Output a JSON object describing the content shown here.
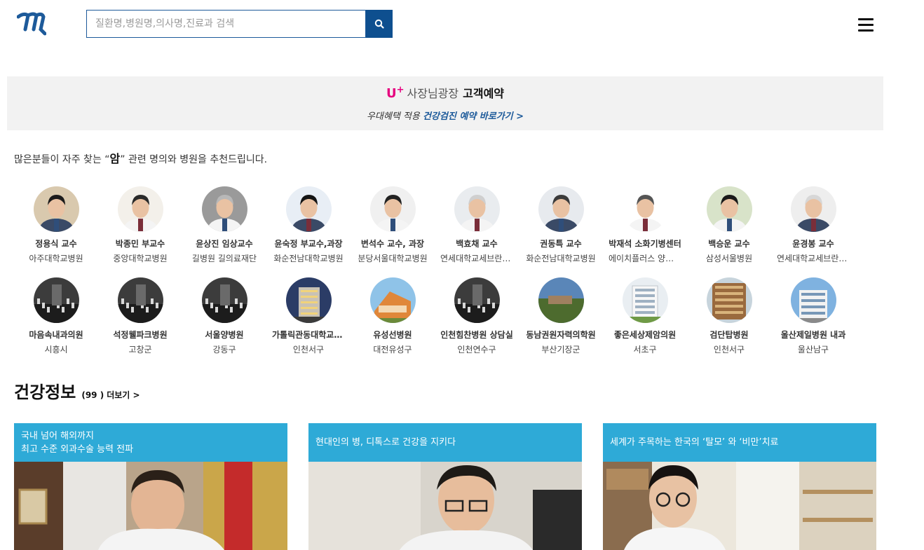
{
  "header": {
    "search_placeholder": "질환명,병원명,의사명,진료과 검색"
  },
  "banner": {
    "brand": "U",
    "brand_plus": "+",
    "brand_name": "사장님광장",
    "title_strong": "고객예약",
    "sub_prefix": "우대혜택 적용 ",
    "sub_link": "건강검진 예약 바로가기 >"
  },
  "recommend": {
    "prefix": "많은분들이 자주 찾는 “",
    "keyword": "암",
    "suffix": "” 관련 명의와 병원을 추천드립니다."
  },
  "doctors": [
    {
      "name": "정용식 교수",
      "hospital": "아주대학교병원"
    },
    {
      "name": "박종민 부교수",
      "hospital": "중앙대학교병원"
    },
    {
      "name": "윤상진 임상교수",
      "hospital": "길병원 길의료재단"
    },
    {
      "name": "윤숙정 부교수,과장",
      "hospital": "화순전남대학교병원"
    },
    {
      "name": "변석수 교수, 과장",
      "hospital": "분당서울대학교병원"
    },
    {
      "name": "백효채 교수",
      "hospital": "연세대학교세브란스병원"
    },
    {
      "name": "권동특 교수",
      "hospital": "화순전남대학교병원"
    },
    {
      "name": "박재석 소화기병센터",
      "hospital": "에이치플러스 양지병원"
    },
    {
      "name": "백승운 교수",
      "hospital": "삼성서울병원"
    },
    {
      "name": "윤경봉 교수",
      "hospital": "연세대학교세브란스병원"
    }
  ],
  "hospitals": [
    {
      "name": "마음속내과의원",
      "region": "시흥시",
      "photo": "night"
    },
    {
      "name": "석정웰파크병원",
      "region": "고창군",
      "photo": "night"
    },
    {
      "name": "서울양병원",
      "region": "강동구",
      "photo": "night"
    },
    {
      "name": "가톨릭관동대학교 국제성모병원",
      "region": "인천서구",
      "photo": "building-night"
    },
    {
      "name": "유성선병원",
      "region": "대전유성구",
      "photo": "building-orange"
    },
    {
      "name": "인천힘찬병원 상담실",
      "region": "인천연수구",
      "photo": "night"
    },
    {
      "name": "동남권원자력의학원",
      "region": "부산기장군",
      "photo": "campus"
    },
    {
      "name": "좋은세상제암의원",
      "region": "서초구",
      "photo": "building-white"
    },
    {
      "name": "검단탑병원",
      "region": "인천서구",
      "photo": "building-brown"
    },
    {
      "name": "울산제일병원 내과",
      "region": "울산남구",
      "photo": "building-sky"
    }
  ],
  "health": {
    "title": "건강정보",
    "count": "(99 )",
    "more": "더보기 >",
    "articles": [
      {
        "line1": "국내 넘어 해외까지",
        "line2": "최고 수준 외과수술 능력 전파"
      },
      {
        "line1": "현대인의 병, 디톡스로 건강을 지키다",
        "line2": ""
      },
      {
        "line1": "세계가 주목하는 한국의 ‘탈모’ 와 ‘비만’치료",
        "line2": ""
      }
    ]
  }
}
